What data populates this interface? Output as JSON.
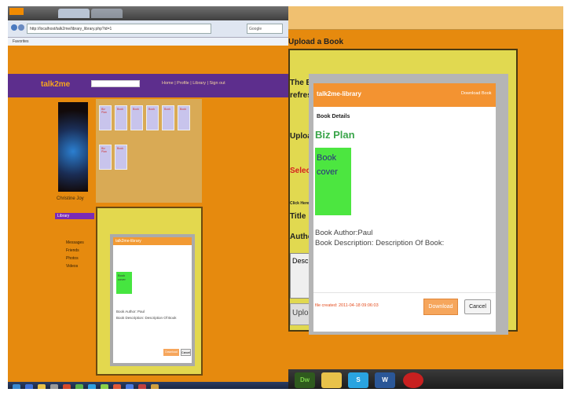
{
  "left_screen": {
    "browser": {
      "address": "http://localhost/talk2me/library_library.php?id=1",
      "search_placeholder": "Google",
      "favorites": "Favorites"
    },
    "site": {
      "logo": "talk2me",
      "header_links": "Home | Profile | Library | Sign out",
      "username": "Christine Joy",
      "active_item": "Library",
      "menu": [
        "Messages",
        "Friends",
        "Photos",
        "Videos"
      ],
      "book_tiles": [
        "Biz Plan",
        "Book",
        "Book",
        "Book",
        "Book",
        "Book",
        "Biz Plan",
        "Book"
      ]
    },
    "mini_modal": {
      "title": "talk2me-library",
      "cover": "Book cover",
      "author": "Book Author: Paul",
      "description": "Book Description: Description Of Book",
      "download": "Download",
      "cancel": "Cancel"
    }
  },
  "right_screen": {
    "upload_heading": "Upload a Book",
    "bg_labels": [
      "The Bo",
      "refresh",
      "Upload",
      "Click Here",
      "Title",
      "Author",
      "Desc",
      "Uploa"
    ],
    "bg_select": "Select",
    "modal": {
      "title": "talk2me-library",
      "download_link": "Download Book",
      "section": "Book Details",
      "book_title": "Biz Plan",
      "cover": [
        "Book",
        "cover"
      ],
      "author": "Book Author:Paul",
      "description": "Book Description: Description Of Book:",
      "created": "file created: 2011-04-18 09:06:03",
      "download": "Download",
      "cancel": "Cancel"
    },
    "taskbar": [
      "Dw",
      "folder-icon",
      "skype-icon",
      "word-icon",
      "stop-icon"
    ]
  },
  "colors": {
    "page_orange": "#e68a0e",
    "header_purple": "#5d2e8d",
    "modal_orange": "#f39331",
    "cover_green": "#4ce640",
    "panel_yellow": "#e1d950"
  }
}
